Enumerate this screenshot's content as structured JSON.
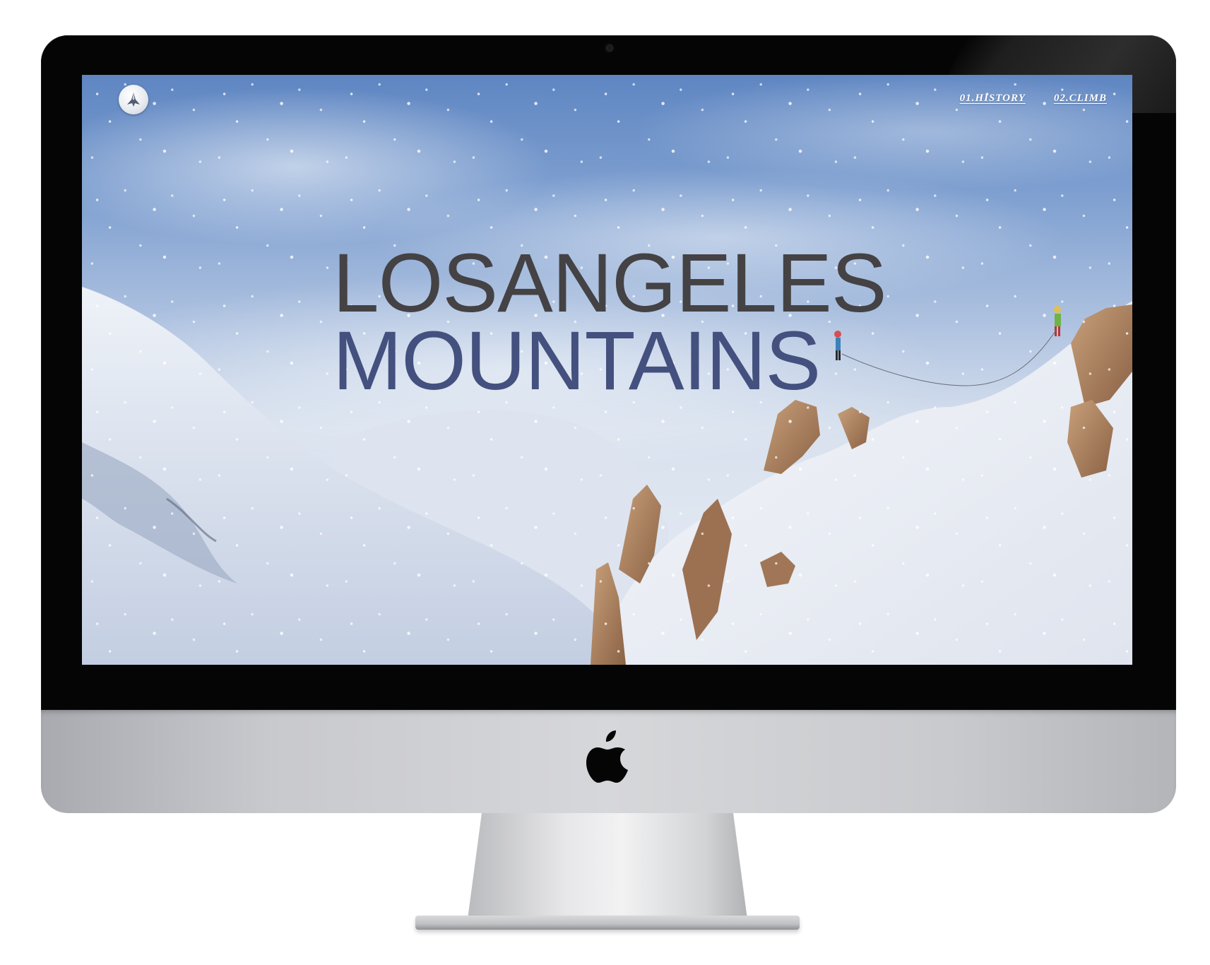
{
  "site": {
    "nav": [
      {
        "label": "01.HISTORY"
      },
      {
        "label": "02.CLIMB"
      }
    ],
    "hero": {
      "line1": "LOSANGELES",
      "line2": "MOUNTAINS"
    }
  },
  "icons": {
    "site_logo": "mountain-peak-icon",
    "device_logo": "apple-logo-icon"
  },
  "colors": {
    "hero_line1": "#444244",
    "hero_line2": "#44507e",
    "nav_text": "#ffffff",
    "bezel": "#050505",
    "chin": "#c8c9cd"
  }
}
